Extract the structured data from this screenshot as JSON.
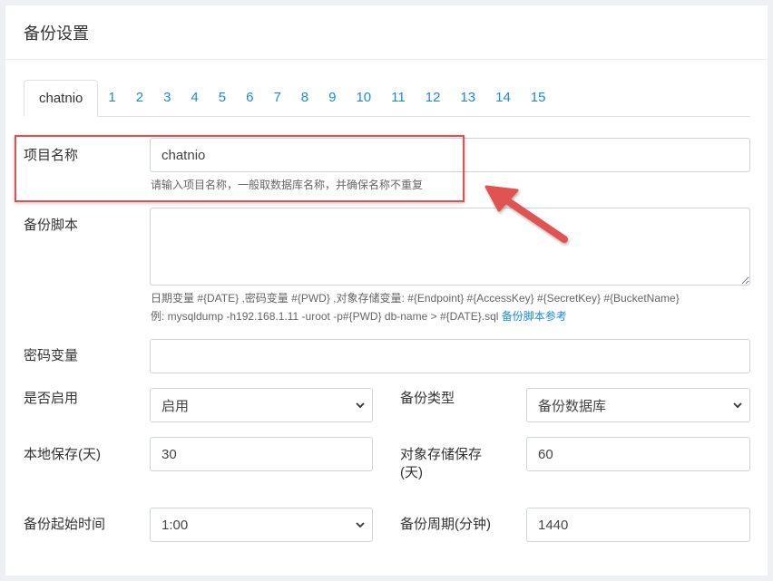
{
  "header": {
    "title": "备份设置"
  },
  "tabs": [
    "chatnio",
    "1",
    "2",
    "3",
    "4",
    "5",
    "6",
    "7",
    "8",
    "9",
    "10",
    "11",
    "12",
    "13",
    "14",
    "15"
  ],
  "form": {
    "project_name": {
      "label": "项目名称",
      "value": "chatnio",
      "help": "请输入项目名称，一般取数据库名称，并确保名称不重复"
    },
    "script": {
      "label": "备份脚本",
      "value": "",
      "help_vars": "日期变量 #{DATE} ,密码变量 #{PWD} ,对象存储变量: #{Endpoint} #{AccessKey} #{SecretKey} #{BucketName}",
      "help_example": "例: mysqldump -h192.168.1.11 -uroot -p#{PWD} db-name > #{DATE}.sql",
      "help_link": "备份脚本参考"
    },
    "password_var": {
      "label": "密码变量",
      "value": ""
    },
    "enabled": {
      "label": "是否启用",
      "value": "启用"
    },
    "backup_type": {
      "label": "备份类型",
      "value": "备份数据库"
    },
    "local_keep": {
      "label": "本地保存(天)",
      "value": "30"
    },
    "oss_keep": {
      "label_line1": "对象存储保存",
      "label_line2": "(天)",
      "value": "60"
    },
    "start_time": {
      "label": "备份起始时间",
      "value": "1:00"
    },
    "period": {
      "label": "备份周期(分钟)",
      "value": "1440"
    }
  },
  "icons": {
    "select": "chevron-down-icon",
    "annotation": "red-arrow-icon"
  },
  "colors": {
    "accent": "#1a8ad8",
    "annotation": "#e05252"
  }
}
